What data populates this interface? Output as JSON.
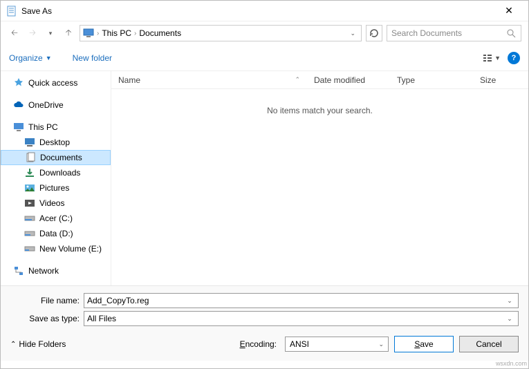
{
  "window": {
    "title": "Save As"
  },
  "breadcrumb": {
    "root": "This PC",
    "folder": "Documents"
  },
  "search": {
    "placeholder": "Search Documents"
  },
  "toolbar": {
    "organize": "Organize",
    "new_folder": "New folder"
  },
  "columns": {
    "name": "Name",
    "date": "Date modified",
    "type": "Type",
    "size": "Size"
  },
  "empty_msg": "No items match your search.",
  "tree": {
    "quick_access": "Quick access",
    "onedrive": "OneDrive",
    "this_pc": "This PC",
    "desktop": "Desktop",
    "documents": "Documents",
    "downloads": "Downloads",
    "pictures": "Pictures",
    "videos": "Videos",
    "acer": "Acer (C:)",
    "data": "Data (D:)",
    "newvol": "New Volume (E:)",
    "network": "Network"
  },
  "form": {
    "filename_label": "File name:",
    "filename_value": "Add_CopyTo.reg",
    "type_label": "Save as type:",
    "type_value": "All Files"
  },
  "bottom": {
    "hide_folders": "Hide Folders",
    "encoding_label": "Encoding:",
    "encoding_value": "ANSI",
    "save": "Save",
    "cancel": "Cancel"
  },
  "watermark": "wsxdn.com"
}
